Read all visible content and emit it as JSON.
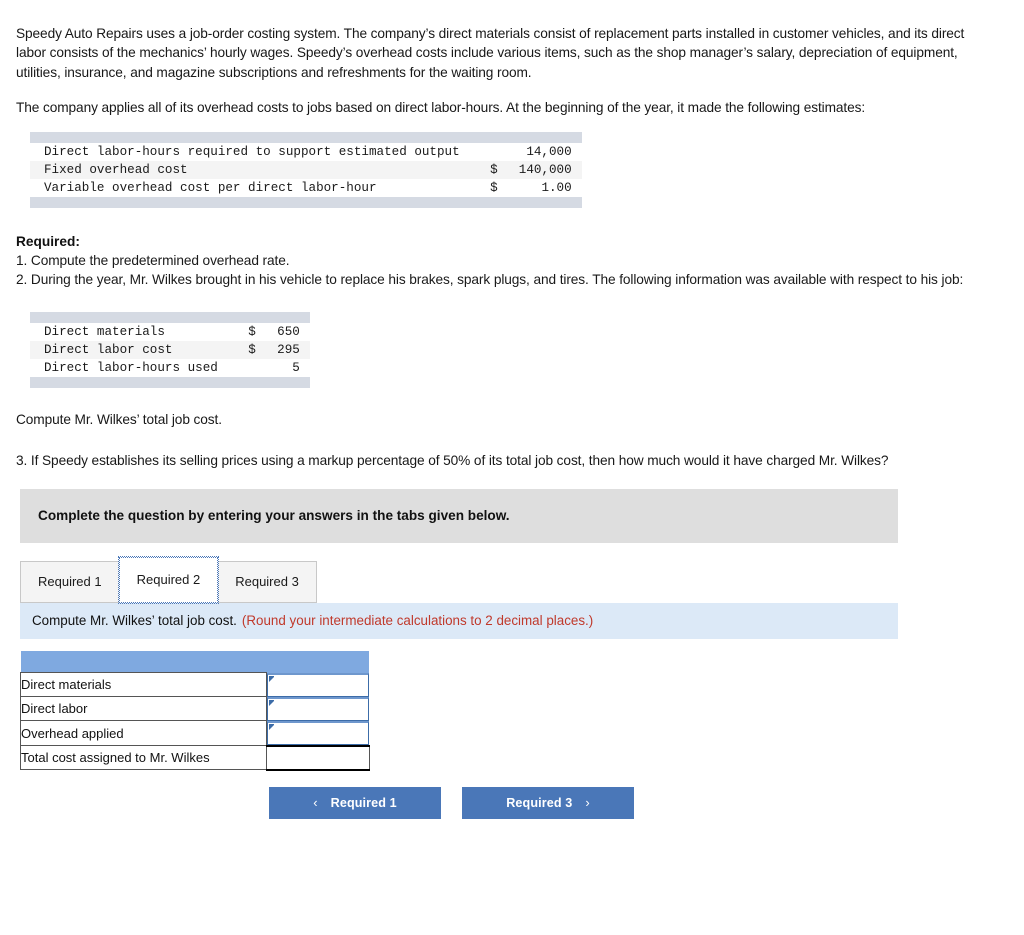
{
  "problem": {
    "paragraph_1": "Speedy Auto Repairs uses a job-order costing system. The company’s direct materials consist of replacement parts installed in customer vehicles, and its direct labor consists of the mechanics’ hourly wages. Speedy’s overhead costs include various items, such as the shop manager’s salary, depreciation of equipment, utilities, insurance, and magazine subscriptions and refreshments for the waiting room.",
    "paragraph_2": "The company applies all of its overhead costs to jobs based on direct labor-hours. At the beginning of the year, it made the following estimates:",
    "estimates_table": {
      "rows": [
        {
          "label": "Direct labor-hours required to support estimated output",
          "value": "14,000",
          "currency": ""
        },
        {
          "label": "Fixed overhead cost",
          "value": "140,000",
          "currency": "$"
        },
        {
          "label": "Variable overhead cost per direct labor-hour",
          "value": "1.00",
          "currency": "$"
        }
      ]
    },
    "required_heading": "Required:",
    "required_1": "1. Compute the predetermined overhead rate.",
    "required_2": "2. During the year, Mr. Wilkes brought in his vehicle to replace his brakes, spark plugs, and tires. The following information was available with respect to his job:",
    "job_table": {
      "rows": [
        {
          "label": "Direct materials",
          "value": "650",
          "currency": "$"
        },
        {
          "label": "Direct labor cost",
          "value": "295",
          "currency": "$"
        },
        {
          "label": "Direct labor-hours used",
          "value": "5",
          "currency": ""
        }
      ]
    },
    "compute_line": "Compute Mr. Wilkes’ total job cost.",
    "required_3": "3. If Speedy establishes its selling prices using a markup percentage of 50% of its total job cost, then how much would it have charged Mr. Wilkes?"
  },
  "answer_panel": {
    "complete_banner": "Complete the question by entering your answers in the tabs given below.",
    "tabs": [
      {
        "label": "Required 1",
        "active": false
      },
      {
        "label": "Required 2",
        "active": true
      },
      {
        "label": "Required 3",
        "active": false
      }
    ],
    "instruction": "Compute Mr. Wilkes’ total job cost.",
    "instruction_note": "(Round your intermediate calculations to 2 decimal places.)",
    "answer_table": {
      "header_left": "",
      "header_right": "",
      "rows": [
        {
          "label": "Direct materials",
          "value": "",
          "type": "input"
        },
        {
          "label": "Direct labor",
          "value": "",
          "type": "input"
        },
        {
          "label": "Overhead applied",
          "value": "",
          "type": "input"
        },
        {
          "label": "Total cost assigned to Mr. Wilkes",
          "value": "",
          "type": "total"
        }
      ]
    },
    "nav": {
      "prev_label": "Required 1",
      "prev_icon": "chevron-left-icon",
      "prev_chevron": "‹",
      "next_label": "Required 3",
      "next_icon": "chevron-right-icon",
      "next_chevron": "›"
    }
  },
  "colors": {
    "button_blue": "#4a77b8",
    "table_header_blue": "#7fa9e0",
    "instruction_bg": "#dce9f7",
    "banner_gray": "#dedede",
    "band_gray": "#d5dae3",
    "note_red": "#c0392b"
  }
}
